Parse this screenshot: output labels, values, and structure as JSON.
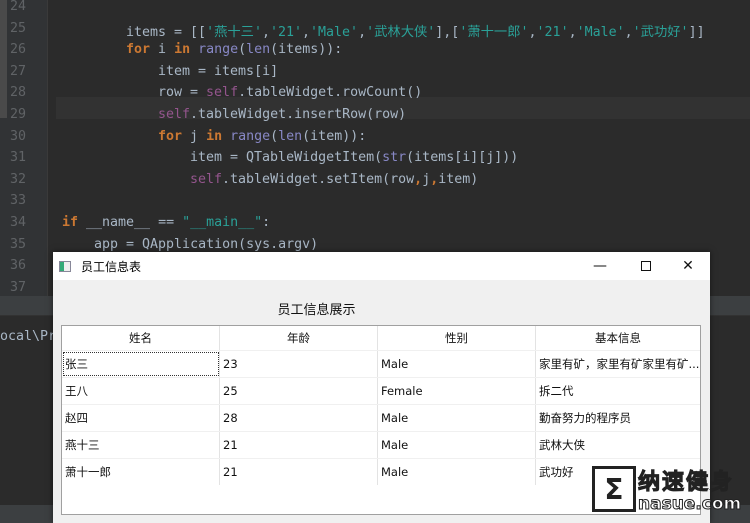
{
  "editor": {
    "line_numbers": [
      "24",
      "25",
      "26",
      "27",
      "28",
      "29",
      "30",
      "31",
      "32",
      "33",
      "34",
      "35",
      "36",
      "37"
    ],
    "lines": [
      [],
      [
        [
          "items = [[",
          ""
        ],
        [
          "'燕十三'",
          "str2"
        ],
        [
          ",",
          ""
        ],
        [
          "'21'",
          "str2"
        ],
        [
          ",",
          ""
        ],
        [
          "'Male'",
          "str2"
        ],
        [
          ",",
          ""
        ],
        [
          "'武林大侠'",
          "str2"
        ],
        [
          "],[",
          ""
        ],
        [
          "'萧十一郎'",
          "str2"
        ],
        [
          ",",
          ""
        ],
        [
          "'21'",
          "str2"
        ],
        [
          ",",
          ""
        ],
        [
          "'Male'",
          "str2"
        ],
        [
          ",",
          ""
        ],
        [
          "'武功好'",
          "str2"
        ],
        [
          "]]",
          ""
        ]
      ],
      [
        [
          "for",
          "kw"
        ],
        [
          " i ",
          ""
        ],
        [
          "in",
          "kw"
        ],
        [
          " ",
          ""
        ],
        [
          "range",
          "fn"
        ],
        [
          "(",
          ""
        ],
        [
          "len",
          "fn"
        ],
        [
          "(items)):",
          ""
        ]
      ],
      [
        [
          "item = items[i]",
          ""
        ]
      ],
      [
        [
          "row = ",
          ""
        ],
        [
          "self",
          "self"
        ],
        [
          ".tableWidget.rowCount()",
          ""
        ]
      ],
      [
        [
          "self",
          "self"
        ],
        [
          ".tableWidget.insertRow(row)",
          ""
        ]
      ],
      [
        [
          "for",
          "kw"
        ],
        [
          " j ",
          ""
        ],
        [
          "in",
          "kw"
        ],
        [
          " ",
          ""
        ],
        [
          "range",
          "fn"
        ],
        [
          "(",
          ""
        ],
        [
          "len",
          "fn"
        ],
        [
          "(item)):",
          ""
        ]
      ],
      [
        [
          "item = QTableWidgetItem(",
          ""
        ],
        [
          "str",
          "fn"
        ],
        [
          "(items[i][j]))",
          ""
        ]
      ],
      [
        [
          "self",
          "self"
        ],
        [
          ".tableWidget.setItem(row",
          ""
        ],
        [
          ",",
          "kw"
        ],
        [
          "j",
          ""
        ],
        [
          ",",
          "kw"
        ],
        [
          "item)",
          ""
        ]
      ],
      [],
      [
        [
          "if",
          "kw"
        ],
        [
          " __name__ == ",
          ""
        ],
        [
          "\"__main__\"",
          "str2"
        ],
        [
          ":",
          ""
        ]
      ],
      [
        [
          "app = QApplication(sys.argv)",
          ""
        ]
      ],
      [],
      []
    ],
    "indents": [
      0,
      8,
      8,
      12,
      12,
      12,
      12,
      16,
      16,
      0,
      0,
      4,
      0,
      0
    ]
  },
  "console": {
    "path_fragment": "ocal\\Pr"
  },
  "dialog": {
    "title": "员工信息表",
    "heading": "员工信息展示",
    "table": {
      "headers": [
        "姓名",
        "年龄",
        "性别",
        "基本信息"
      ],
      "rows": [
        [
          "张三",
          "23",
          "Male",
          "家里有矿，家里有矿家里有矿..."
        ],
        [
          "王八",
          "25",
          "Female",
          "拆二代"
        ],
        [
          "赵四",
          "28",
          "Male",
          "勤奋努力的程序员"
        ],
        [
          "燕十三",
          "21",
          "Male",
          "武林大侠"
        ],
        [
          "萧十一郎",
          "21",
          "Male",
          "武功好"
        ]
      ],
      "selected": {
        "row": 0,
        "col": 0
      }
    }
  },
  "watermark": {
    "text": "纳速健身",
    "url": "nasue.com"
  }
}
